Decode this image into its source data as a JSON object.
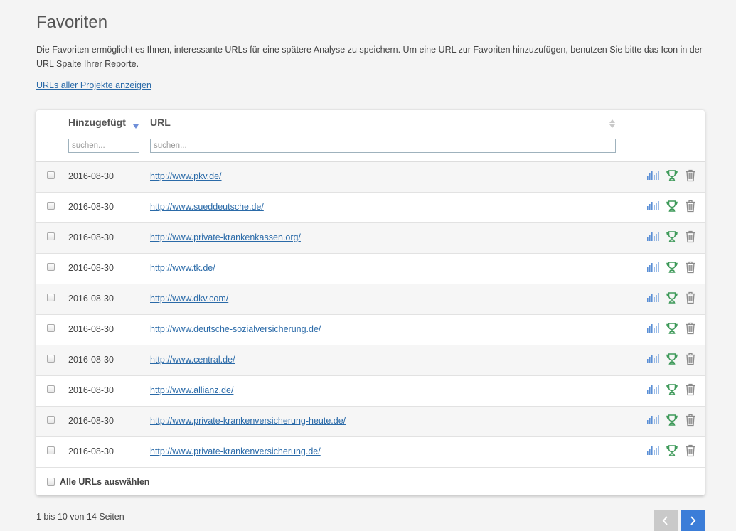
{
  "page": {
    "title": "Favoriten",
    "description": "Die Favoriten ermöglicht es Ihnen, interessante URLs für eine spätere Analyse zu speichern. Um eine URL zur Favoriten hinzuzufügen, benutzen Sie bitte das Icon in der URL Spalte Ihrer Reporte.",
    "all_projects_link": "URLs aller Projekte anzeigen"
  },
  "table": {
    "columns": {
      "date": "Hinzugefügt",
      "url": "URL"
    },
    "sort": {
      "column": "date",
      "direction": "desc"
    },
    "filters": {
      "date_placeholder": "suchen...",
      "url_placeholder": "suchen..."
    },
    "rows": [
      {
        "date": "2016-08-30",
        "url": "http://www.pkv.de/"
      },
      {
        "date": "2016-08-30",
        "url": "http://www.sueddeutsche.de/"
      },
      {
        "date": "2016-08-30",
        "url": "http://www.private-krankenkassen.org/"
      },
      {
        "date": "2016-08-30",
        "url": "http://www.tk.de/"
      },
      {
        "date": "2016-08-30",
        "url": "http://www.dkv.com/"
      },
      {
        "date": "2016-08-30",
        "url": "http://www.deutsche-sozialversicherung.de/"
      },
      {
        "date": "2016-08-30",
        "url": "http://www.central.de/"
      },
      {
        "date": "2016-08-30",
        "url": "http://www.allianz.de/"
      },
      {
        "date": "2016-08-30",
        "url": "http://www.private-krankenversicherung-heute.de/"
      },
      {
        "date": "2016-08-30",
        "url": "http://www.private-krankenversicherung.de/"
      }
    ],
    "row_actions": [
      "bar-chart-icon",
      "trophy-icon",
      "trash-icon"
    ],
    "select_all_label": "Alle URLs auswählen"
  },
  "pagination": {
    "info": "1 bis 10 von 14 Seiten",
    "prev_icon": "chevron-left-icon",
    "next_icon": "chevron-right-icon"
  },
  "colors": {
    "link": "#2a6aa8",
    "stats_icon": "#5b8fd6",
    "trophy_icon": "#3f9a5a",
    "trash_icon": "#8a8a8a",
    "next_button": "#3b7dd8",
    "prev_button": "#c9c9c9"
  }
}
